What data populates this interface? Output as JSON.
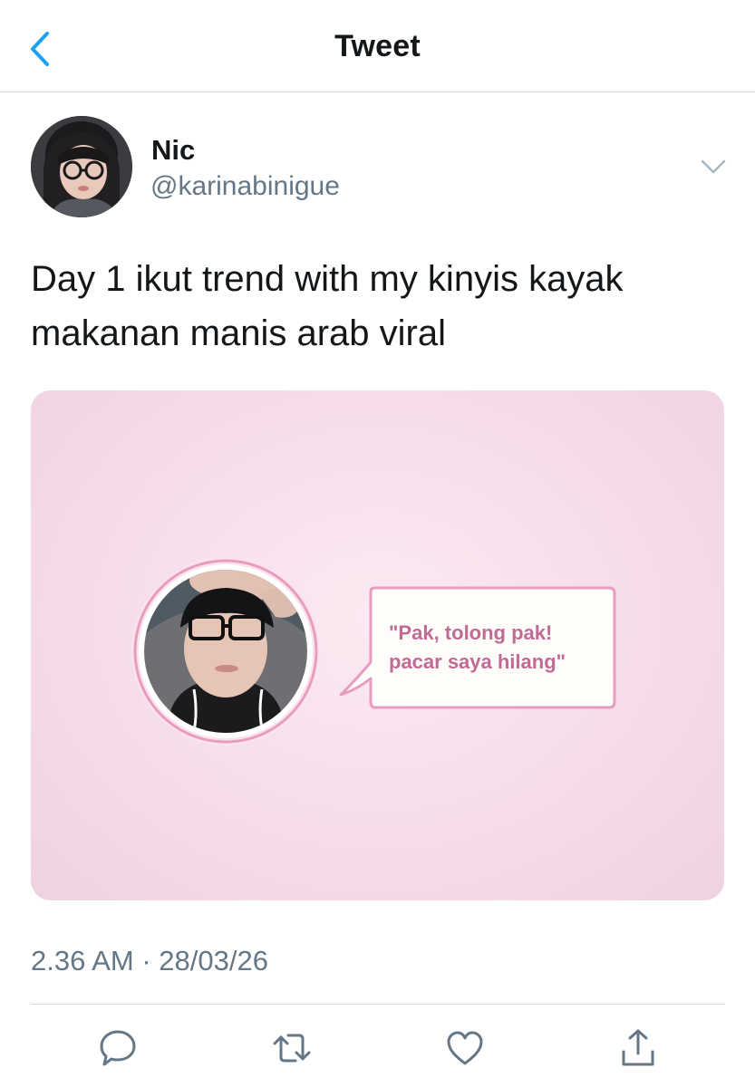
{
  "header": {
    "title": "Tweet",
    "back_icon": "chevron-left-icon"
  },
  "tweet": {
    "display_name": "Nic",
    "handle": "@karinabinigue",
    "text": "Day 1 ikut trend with my kinyis kayak makanan manis arab viral",
    "media": {
      "bubble_text": "\"Pak, tolong pak! pacar saya hilang\""
    },
    "timestamp": "2.36 AM · 28/03/26"
  },
  "actions": [
    "reply-icon",
    "retweet-icon",
    "like-icon",
    "share-icon"
  ],
  "colors": {
    "accent": "#1da1f2",
    "muted": "#657786",
    "divider": "#d6d9dc",
    "bubble_border": "#e79cc0",
    "bubble_text": "#c06a94"
  }
}
